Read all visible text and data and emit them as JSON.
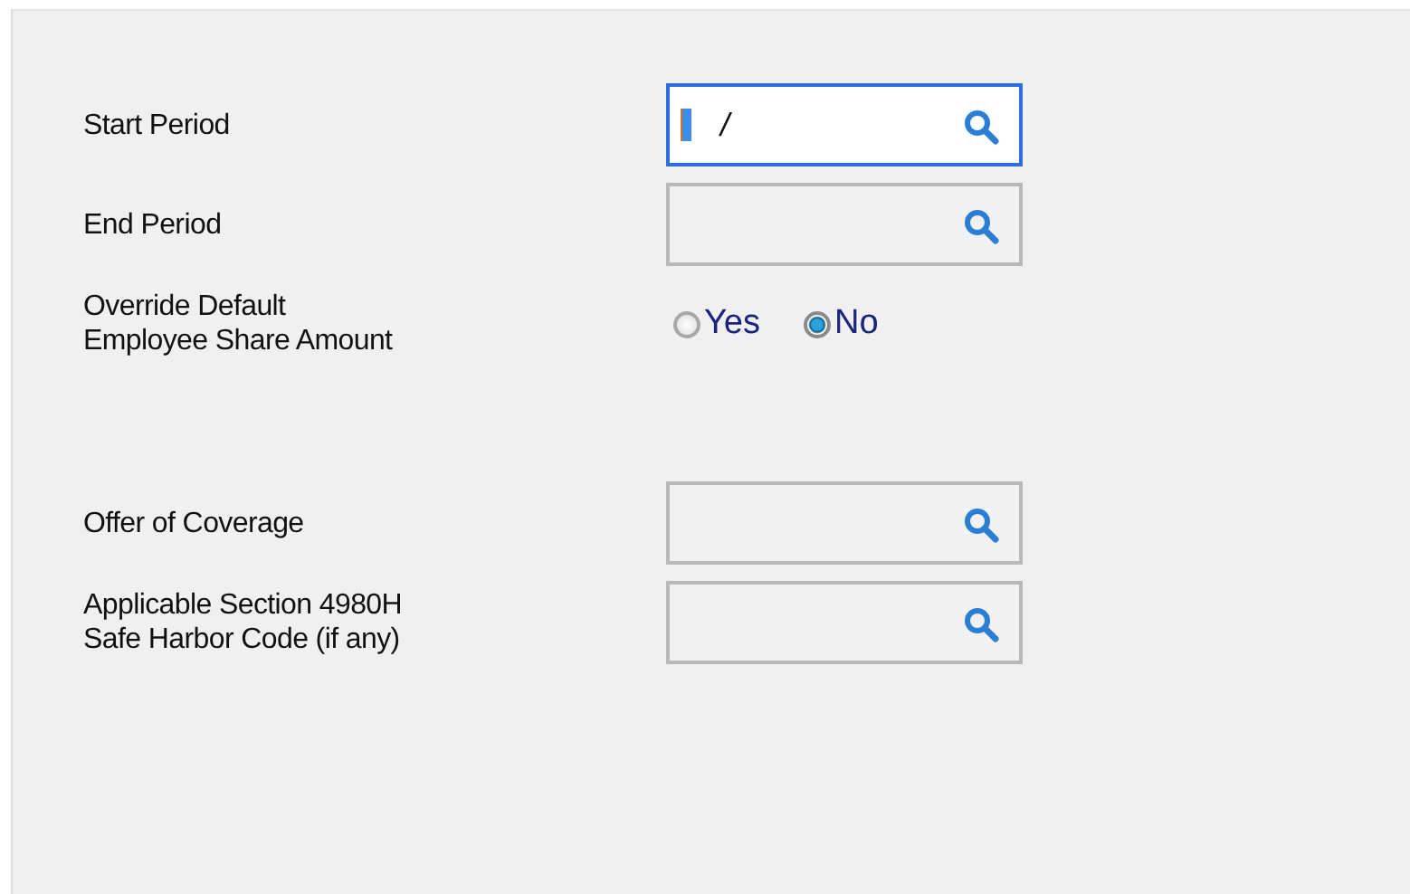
{
  "fields": [
    {
      "kind": "lookup",
      "label": "Start Period",
      "value": "/",
      "focused": true
    },
    {
      "kind": "lookup",
      "label": "End Period",
      "focused": false
    },
    {
      "kind": "radio",
      "label": "Override Default\nEmployee Share Amount",
      "options": [
        {
          "label": "Yes",
          "selected": false
        },
        {
          "label": "No",
          "selected": true
        }
      ]
    },
    {
      "kind": "lookup",
      "label": "Offer of Coverage",
      "focused": false
    },
    {
      "kind": "lookup",
      "label": "Applicable Section 4980H\nSafe Harbor Code (if any)",
      "focused": false
    }
  ]
}
